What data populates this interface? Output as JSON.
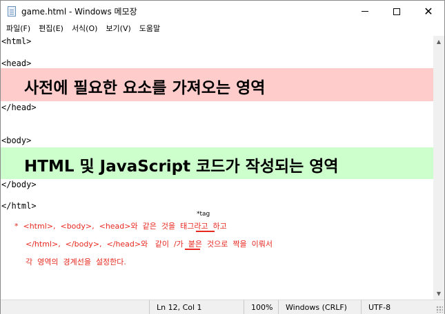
{
  "window": {
    "title": "game.html - Windows 메모장",
    "minimize_glyph": "",
    "close_glyph": "✕"
  },
  "menu": {
    "items": [
      "파일(F)",
      "편집(E)",
      "서식(O)",
      "보기(V)",
      "도움말"
    ]
  },
  "editor": {
    "lines": {
      "html_open": "<html>",
      "head_open": "<head>",
      "head_close": "</head>",
      "body_open": "<body>",
      "body_close": "</body>",
      "html_close": "</html>"
    },
    "pink_band_text": "사전에 필요한 요소를 가져오는 영역",
    "green_band_text": "HTML 및 JavaScript 코드가 작성되는 영역",
    "pink_band_color": "#ffcccc",
    "green_band_color": "#ccffcc",
    "annotation": {
      "superscript": "*tag",
      "line1": "*  <html>,  <body>,  <head>와  같은  것을  태그라고  하고",
      "line2": "</html>,  </body>,  </head>와   같이  /가  붙은  것으로  짝을  이뤄서",
      "line3": "각  영역의  경계선을  설정한다.",
      "color": "#e8281f"
    }
  },
  "status": {
    "position": "Ln 12, Col 1",
    "zoom": "100%",
    "line_ending": "Windows (CRLF)",
    "encoding": "UTF-8"
  }
}
